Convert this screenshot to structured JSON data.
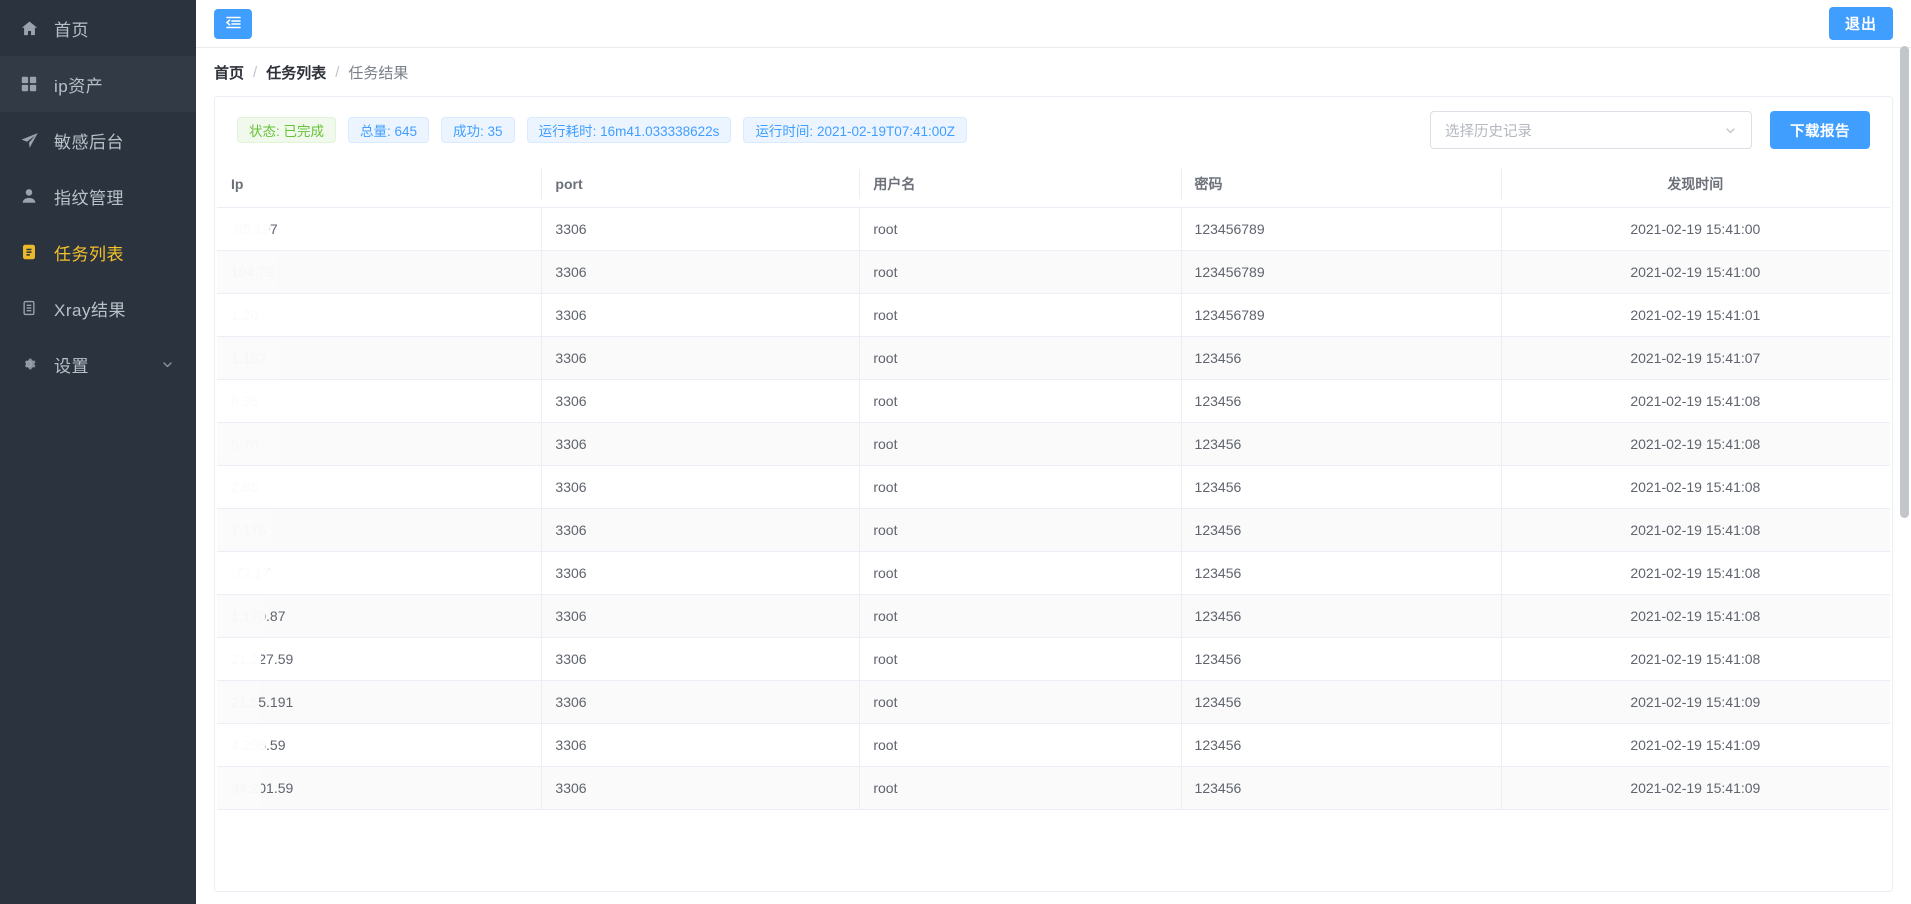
{
  "sidebar": {
    "items": [
      {
        "label": "首页",
        "icon": "home-icon",
        "active": false,
        "shade": "dark"
      },
      {
        "label": "ip资产",
        "icon": "grid-icon",
        "active": false,
        "shade": "light"
      },
      {
        "label": "敏感后台",
        "icon": "send-icon",
        "active": false,
        "shade": "dark"
      },
      {
        "label": "指纹管理",
        "icon": "user-icon",
        "active": false,
        "shade": "dark"
      },
      {
        "label": "任务列表",
        "icon": "clipboard-icon",
        "active": true,
        "shade": "dark"
      },
      {
        "label": "Xray结果",
        "icon": "list-icon",
        "active": false,
        "shade": "dark"
      },
      {
        "label": "设置",
        "icon": "gear-icon",
        "active": false,
        "shade": "dark",
        "chevron": "chevron-down-icon"
      }
    ]
  },
  "topbar": {
    "fold_icon": "menu-fold-icon",
    "logout_label": "退出"
  },
  "breadcrumb": {
    "items": [
      "首页",
      "任务列表",
      "任务结果"
    ],
    "separator": "/"
  },
  "summary": {
    "badges": [
      {
        "text": "状态: 已完成",
        "color": "green"
      },
      {
        "text": "总量: 645",
        "color": "blue"
      },
      {
        "text": "成功: 35",
        "color": "blue"
      },
      {
        "text": "运行耗时: 16m41.033338622s",
        "color": "blue"
      },
      {
        "text": "运行时间: 2021-02-19T07:41:00Z",
        "color": "blue"
      }
    ]
  },
  "history_select": {
    "placeholder": "选择历史记录",
    "value": "",
    "arrow_icon": "chevron-down-icon"
  },
  "download_button": {
    "label": "下载报告"
  },
  "table": {
    "columns": [
      "Ip",
      "port",
      "用户名",
      "密码",
      "发现时间"
    ],
    "rows": [
      {
        "ip": ".85.197",
        "redact_width": 52,
        "port": "3306",
        "user": "root",
        "password": "123456789",
        "time": "2021-02-19 15:41:00"
      },
      {
        "ip": "104.79",
        "redact_width": 60,
        "port": "3306",
        "user": "root",
        "password": "123456789",
        "time": "2021-02-19 15:41:00"
      },
      {
        "ip": "1.20",
        "redact_width": 62,
        "port": "3306",
        "user": "root",
        "password": "123456789",
        "time": "2021-02-19 15:41:01"
      },
      {
        "ip": "1.192",
        "redact_width": 64,
        "port": "3306",
        "user": "root",
        "password": "123456",
        "time": "2021-02-19 15:41:07"
      },
      {
        "ip": "8.35",
        "redact_width": 64,
        "port": "3306",
        "user": "root",
        "password": "123456",
        "time": "2021-02-19 15:41:08"
      },
      {
        "ip": "5.76",
        "redact_width": 62,
        "port": "3306",
        "user": "root",
        "password": "123456",
        "time": "2021-02-19 15:41:08"
      },
      {
        "ip": "2.85",
        "redact_width": 58,
        "port": "3306",
        "user": "root",
        "password": "123456",
        "time": "2021-02-19 15:41:08"
      },
      {
        "ip": "7.176",
        "redact_width": 56,
        "port": "3306",
        "user": "root",
        "password": "123456",
        "time": "2021-02-19 15:41:08"
      },
      {
        "ip": ".72.17",
        "redact_width": 52,
        "port": "3306",
        "user": "root",
        "password": "123456",
        "time": "2021-02-19 15:41:08"
      },
      {
        "ip": "1.170.87",
        "redact_width": 48,
        "port": "3306",
        "user": "root",
        "password": "123456",
        "time": "2021-02-19 15:41:08"
      },
      {
        "ip": "21.227.59",
        "redact_width": 44,
        "port": "3306",
        "user": "root",
        "password": "123456",
        "time": "2021-02-19 15:41:08"
      },
      {
        "ip": "21.55.191",
        "redact_width": 42,
        "port": "3306",
        "user": "root",
        "password": "123456",
        "time": "2021-02-19 15:41:09"
      },
      {
        "ip": "4.206.59",
        "redact_width": 48,
        "port": "3306",
        "user": "root",
        "password": "123456",
        "time": "2021-02-19 15:41:09"
      },
      {
        "ip": "34.201.59",
        "redact_width": 44,
        "port": "3306",
        "user": "root",
        "password": "123456",
        "time": "2021-02-19 15:41:09"
      }
    ]
  },
  "colors": {
    "accent": "#409eff",
    "sidebar_bg": "#2b333e",
    "active_nav": "#f5c22b",
    "badge_green": "#67c23a",
    "badge_blue": "#409eff"
  }
}
